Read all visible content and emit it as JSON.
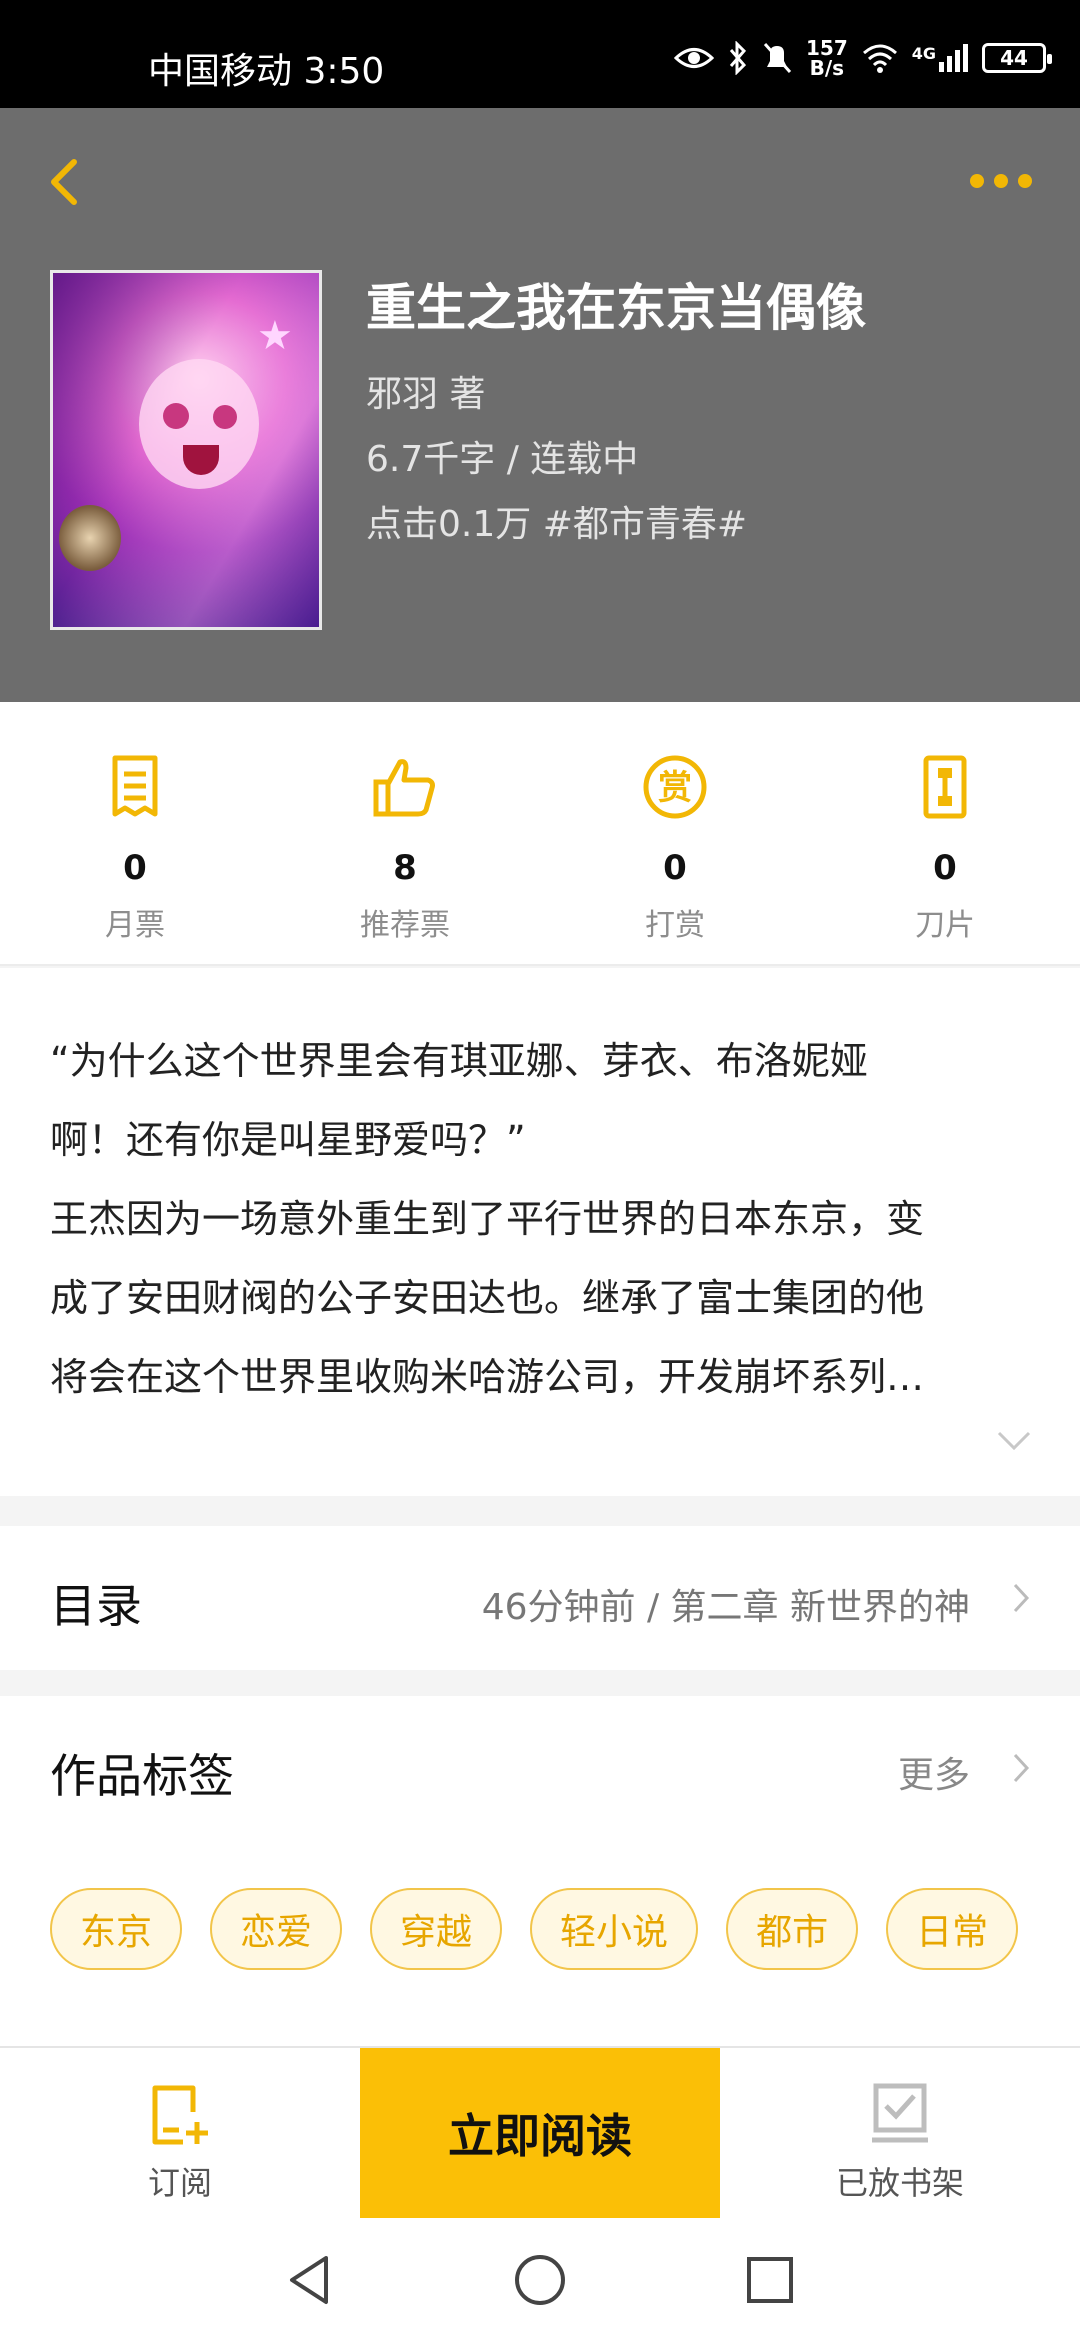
{
  "status_bar": {
    "carrier_time": "中国移动 3:50",
    "net_speed_value": "157",
    "net_speed_unit": "B/s",
    "network": "4G",
    "battery": "44"
  },
  "header": {
    "back_icon": "chevron-left-icon",
    "more_icon": "more-dots-icon"
  },
  "book": {
    "title": "重生之我在东京当偶像",
    "author_line": "邪羽  著",
    "words_line": "6.7千字 / 连载中",
    "clicks_line": "点击0.1万  #都市青春#"
  },
  "stats": [
    {
      "value": "0",
      "label": "月票",
      "icon": "ticket-icon"
    },
    {
      "value": "8",
      "label": "推荐票",
      "icon": "thumbs-up-icon"
    },
    {
      "value": "0",
      "label": "打赏",
      "icon": "reward-coin-icon"
    },
    {
      "value": "0",
      "label": "刀片",
      "icon": "blade-icon"
    }
  ],
  "synopsis": {
    "lines": [
      "“为什么这个世界里会有琪亚娜、芽衣、布洛妮娅",
      "啊！还有你是叫星野爱吗？”",
      "王杰因为一场意外重生到了平行世界的日本东京，变",
      "成了安田财阀的公子安田达也。继承了富士集团的他",
      "将会在这个世界里收购米哈游公司，开发崩坏系列…"
    ]
  },
  "catalog": {
    "title": "目录",
    "latest": "46分钟前 / 第二章 新世界的神"
  },
  "tags_section": {
    "title": "作品标签",
    "more": "更多",
    "tags": [
      "东京",
      "恋爱",
      "穿越",
      "轻小说",
      "都市",
      "日常"
    ]
  },
  "bottom_bar": {
    "subscribe": "订阅",
    "read_now": "立即阅读",
    "shelf": "已放书架"
  },
  "colors": {
    "accent": "#fbbf06",
    "header_bg": "#6d6d6d",
    "tag_text": "#e7a600"
  }
}
